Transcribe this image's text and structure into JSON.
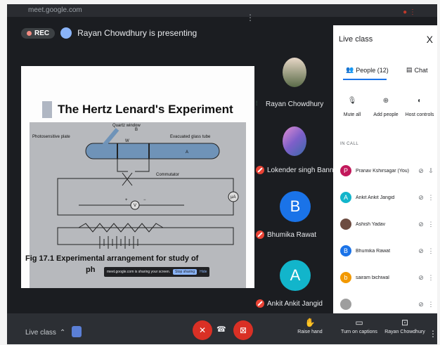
{
  "browser": {
    "url": "meet.google.com"
  },
  "header": {
    "rec_label": "REC",
    "presenting_text": "Rayan Chowdhury is presenting"
  },
  "slide": {
    "title": "The Hertz Lenard's Experiment",
    "diagram_labels": {
      "quartz": "Quartz window",
      "b": "B",
      "w": "W",
      "photosensitive": "Photosensitive plate",
      "evacuated": "Evacuated glass tube",
      "a": "A",
      "commutator": "Commutator",
      "ua": "µA",
      "v": "V",
      "plus": "+",
      "minus": "−"
    },
    "caption": "Fig 17.1 Experimental arrangement for study of",
    "caption_line2": "ph",
    "share_notice": "meet.google.com is sharing your screen.",
    "stop_sharing": "Stop sharing",
    "hide": "Hide"
  },
  "tiles": [
    {
      "name": "Rayan Chowdhury",
      "mic": "on"
    },
    {
      "name": "Lokender singh Bannaji",
      "mic": "off"
    },
    {
      "name": "Bhumika Rawat",
      "mic": "off",
      "letter": "B",
      "color": "#1a73e8"
    },
    {
      "name": "Ankit Ankit Jangid",
      "mic": "off",
      "letter": "A",
      "color": "#12b5cb"
    }
  ],
  "panel": {
    "title": "Live class",
    "close": "X",
    "tab_people": "People (12)",
    "tab_chat": "Chat",
    "action_mute_all": "Mute all",
    "action_add_people": "Add people",
    "action_host_controls": "Host controls",
    "in_call": "IN CALL",
    "people": [
      {
        "name": "Pranav Kshirsagar (You)",
        "letter": "P",
        "color": "#c2185b"
      },
      {
        "name": "Ankit Ankit Jangid",
        "letter": "A",
        "color": "#12b5cb"
      },
      {
        "name": "Ashish Yadav",
        "letter": "",
        "color": "#6d4c41"
      },
      {
        "name": "Bhumika Rawat",
        "letter": "B",
        "color": "#1a73e8"
      },
      {
        "name": "sairam bichiwal",
        "letter": "b",
        "color": "#f29900"
      },
      {
        "name": "",
        "letter": "",
        "color": "#9e9e9e"
      }
    ]
  },
  "bottom": {
    "live_class": "Live class",
    "raise_hand": "Raise hand",
    "captions": "Turn on captions",
    "presenting": "Rayan Chowdhury"
  }
}
